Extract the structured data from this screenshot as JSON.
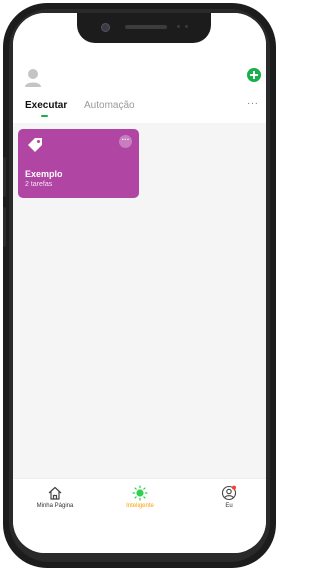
{
  "header": {
    "avatar_icon": "user-avatar-icon",
    "add_icon": "plus-circle-icon"
  },
  "tabs": [
    {
      "label": "Executar",
      "active": true
    },
    {
      "label": "Automação",
      "active": false
    }
  ],
  "more_label": "···",
  "scenes": [
    {
      "name": "Exemplo",
      "subtitle": "2 tarefas",
      "color": "#b145a3",
      "icon": "tag-icon"
    }
  ],
  "bottom_nav": {
    "items": [
      {
        "label": "Minha Página",
        "icon": "home-icon",
        "active": false
      },
      {
        "label": "Inteligente",
        "icon": "sun-icon",
        "active": true
      },
      {
        "label": "Eu",
        "icon": "user-circle-icon",
        "active": false
      }
    ]
  },
  "colors": {
    "accent_green": "#17b04a",
    "active_nav": "#ff9d00",
    "card": "#b145a3"
  }
}
